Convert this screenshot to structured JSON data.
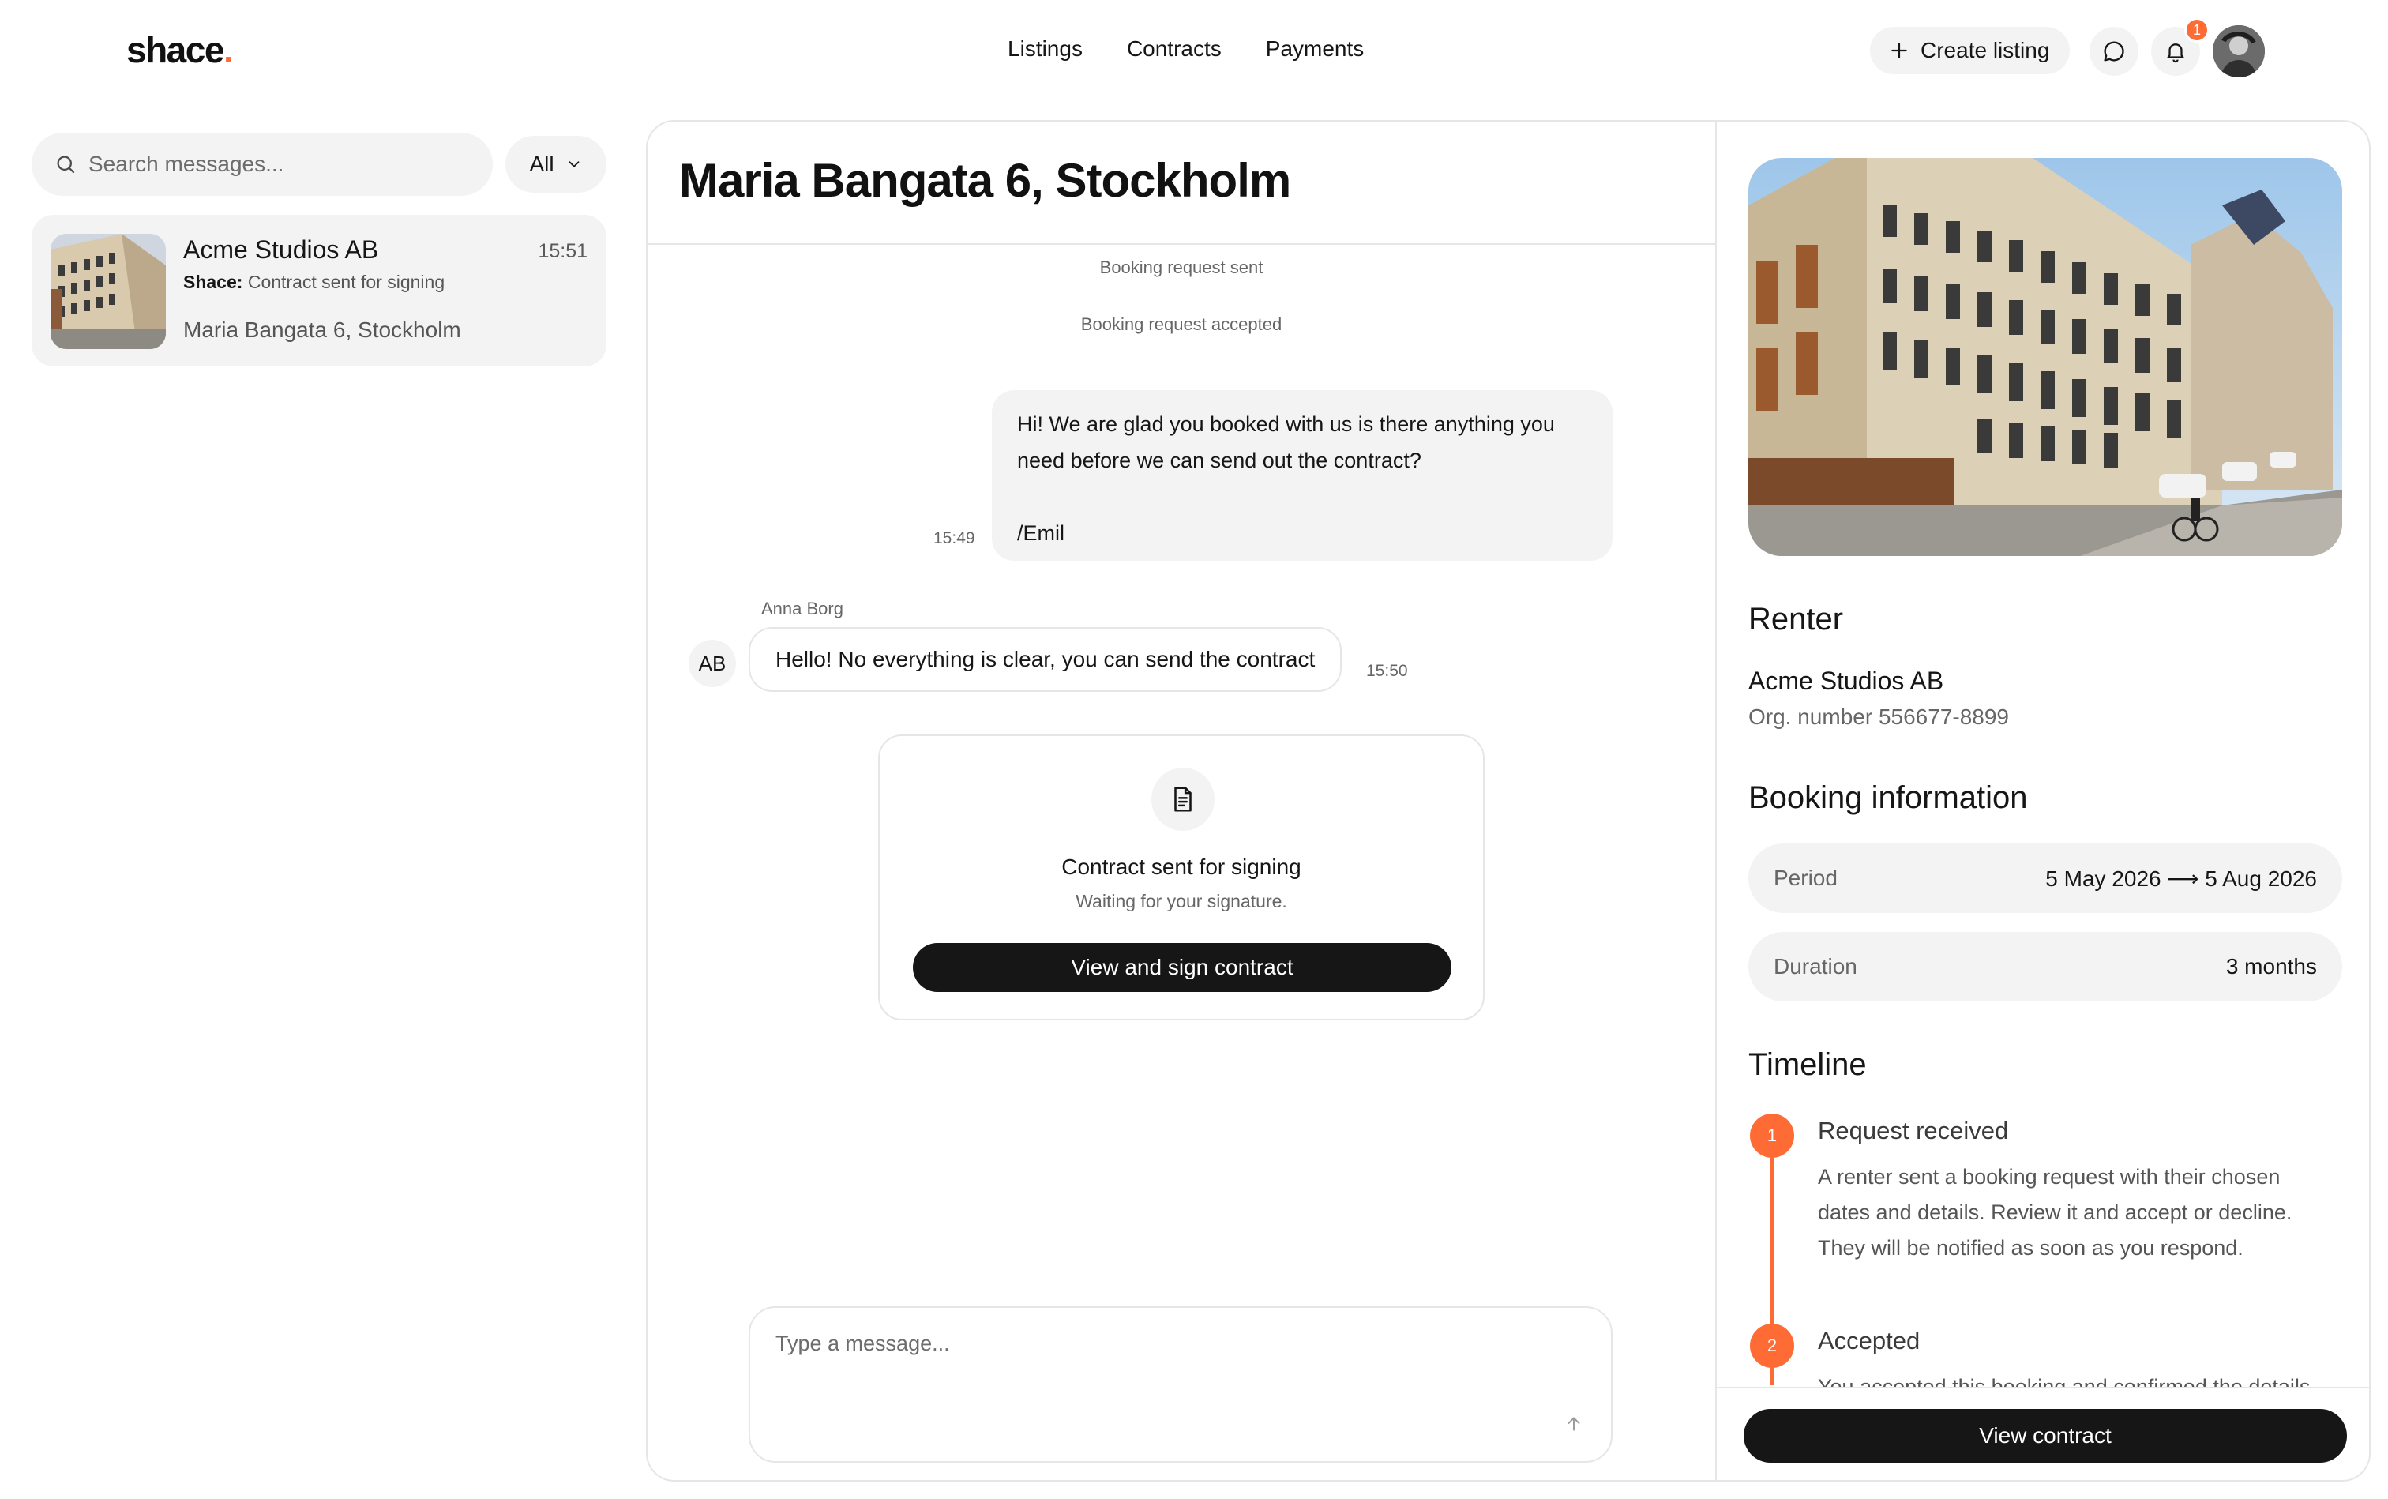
{
  "header": {
    "logo_text": "shace",
    "logo_dot": ".",
    "nav": [
      "Listings",
      "Contracts",
      "Payments"
    ],
    "create_listing_label": "Create listing",
    "notification_count": "1"
  },
  "sidebar": {
    "search_placeholder": "Search messages...",
    "filter_label": "All",
    "conversations": [
      {
        "name": "Acme Studios AB",
        "time": "15:51",
        "sender": "Shace:",
        "preview": "Contract sent for signing",
        "address": "Maria Bangata 6, Stockholm"
      }
    ]
  },
  "chat": {
    "title": "Maria Bangata 6, Stockholm",
    "system_messages": [
      "Booking request sent",
      "Booking request accepted"
    ],
    "outgoing": {
      "line1": "Hi! We are glad you booked with us is there anything you",
      "line2": "need before we can send out the contract?",
      "signature": "/Emil",
      "time": "15:49"
    },
    "incoming": {
      "sender": "Anna Borg",
      "initials": "AB",
      "text": "Hello! No everything is clear, you can send the contract",
      "time": "15:50"
    },
    "contract_card": {
      "title": "Contract sent for signing",
      "subtitle": "Waiting for your signature.",
      "button_label": "View and sign contract"
    },
    "composer_placeholder": "Type a message..."
  },
  "details": {
    "renter_heading": "Renter",
    "renter_name": "Acme Studios AB",
    "renter_org": "Org. number 556677-8899",
    "booking_heading": "Booking information",
    "period_label": "Period",
    "period_value": "5 May 2026 ⟶ 5 Aug 2026",
    "duration_label": "Duration",
    "duration_value": "3 months",
    "timeline_heading": "Timeline",
    "timeline": [
      {
        "step": "1",
        "title": "Request received",
        "description": "A renter sent a booking request with their chosen dates and details. Review it and accept or decline. They will be notified as soon as you respond."
      },
      {
        "step": "2",
        "title": "Accepted",
        "description": "You accepted this booking and confirmed the details."
      }
    ],
    "view_contract_label": "View contract"
  },
  "colors": {
    "accent": "#ff6b35",
    "primary_button": "#161616",
    "surface": "#f3f3f3",
    "border": "#e6e6e6"
  },
  "icons": [
    "plus-icon",
    "chat-bubble-icon",
    "bell-icon",
    "search-icon",
    "chevron-down-icon",
    "document-icon",
    "arrow-up-icon"
  ]
}
